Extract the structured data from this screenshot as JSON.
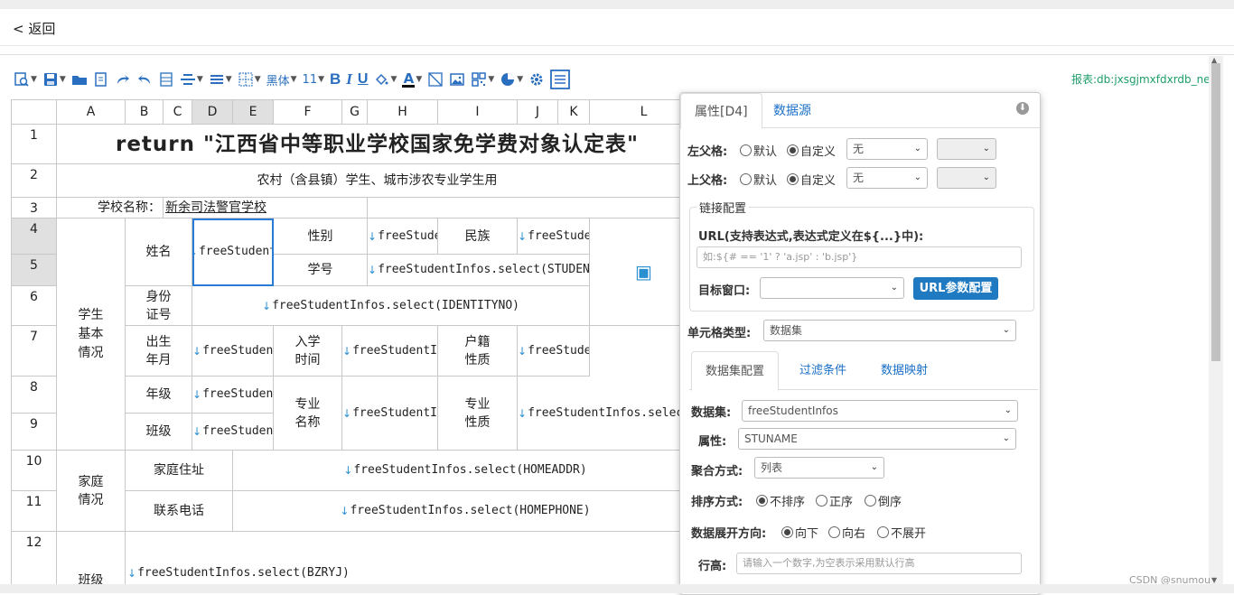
{
  "back_label": "< 返回",
  "report_name": "报表:db:jxsgjmxfdxrdb_new",
  "toolbar": {
    "font_family": "黑体",
    "font_size": "11",
    "bold": "B",
    "italic": "I",
    "underline": "U",
    "font_color_letter": "A"
  },
  "grid": {
    "columns": [
      "A",
      "B",
      "C",
      "D",
      "E",
      "F",
      "G",
      "H",
      "I",
      "J",
      "K",
      "L"
    ],
    "rows": [
      "1",
      "2",
      "3",
      "4",
      "5",
      "6",
      "7",
      "8",
      "9",
      "10",
      "11",
      "12"
    ],
    "title": "return \"江西省中等职业学校国家免学费对象认定表\"",
    "subtitle": "农村（含县镇）学生、城市涉农专业学生用",
    "school_label": "学校名称：",
    "school_name": "新余司法警官学校",
    "student_basic": "学生\n基本\n情况",
    "name_label": "姓名",
    "gender_label": "性别",
    "nation_label": "民族",
    "studentno_label": "学号",
    "idno_label": "身份\n证号",
    "birth_label": "出生\n年月",
    "enroll_label": "入学\n时间",
    "huji_label": "户籍\n性质",
    "grade_label": "年级",
    "major_name_label": "专业\n名称",
    "major_nature_label": "专业\n性质",
    "class_label": "班级",
    "family_label": "家庭\n情况",
    "home_addr_label": "家庭住址",
    "phone_label": "联系电话",
    "class_bottom_label": "班级",
    "cell_name": "freeStudent",
    "cell_gender": "freeStuder",
    "cell_nation": "freeStuden",
    "cell_studentno": "freeStudentInfos.select(STUDENTNO",
    "cell_idno": "freeStudentInfos.select(IDENTITYNO)",
    "cell_birth": "freeStudent",
    "cell_enroll": "freeStudentInf",
    "cell_huji": "freeStuden",
    "cell_grade": "freeStudent",
    "cell_major": "freeStudentInf",
    "cell_major_nature": "freeStudentInfos.select(",
    "cell_class": "freeStudent",
    "cell_homeaddr": "freeStudentInfos.select(HOMEADDR)",
    "cell_phone": "freeStudentInfos.select(HOMEPHONE)",
    "cell_bzryj": "freeStudentInfos.select(BZRYJ)"
  },
  "panel": {
    "tab_props": "属性[D4]",
    "tab_datasource": "数据源",
    "left_parent_label": "左父格:",
    "top_parent_label": "上父格:",
    "radio_default": "默认",
    "radio_custom": "自定义",
    "left_parent_value": "无",
    "top_parent_value": "无",
    "link_legend": "链接配置",
    "url_label": "URL(支持表达式,表达式定义在${...}中):",
    "url_placeholder": "如:${# == '1' ? 'a.jsp' : 'b.jsp'}",
    "target_label": "目标窗口:",
    "url_param_button": "URL参数配置",
    "cell_type_label": "单元格类型:",
    "cell_type_value": "数据集",
    "subtab_dataset": "数据集配置",
    "subtab_filter": "过滤条件",
    "subtab_mapping": "数据映射",
    "dataset_label": "数据集:",
    "dataset_value": "freeStudentInfos",
    "attr_label": "属性:",
    "attr_value": "STUNAME",
    "agg_label": "聚合方式:",
    "agg_value": "列表",
    "sort_label": "排序方式:",
    "sort_none": "不排序",
    "sort_asc": "正序",
    "sort_desc": "倒序",
    "expand_label": "数据展开方向:",
    "expand_down": "向下",
    "expand_right": "向右",
    "expand_none": "不展开",
    "row_height_label": "行高:",
    "row_height_placeholder": "请输入一个数字,为空表示采用默认行高"
  },
  "watermark": "CSDN @snumou"
}
